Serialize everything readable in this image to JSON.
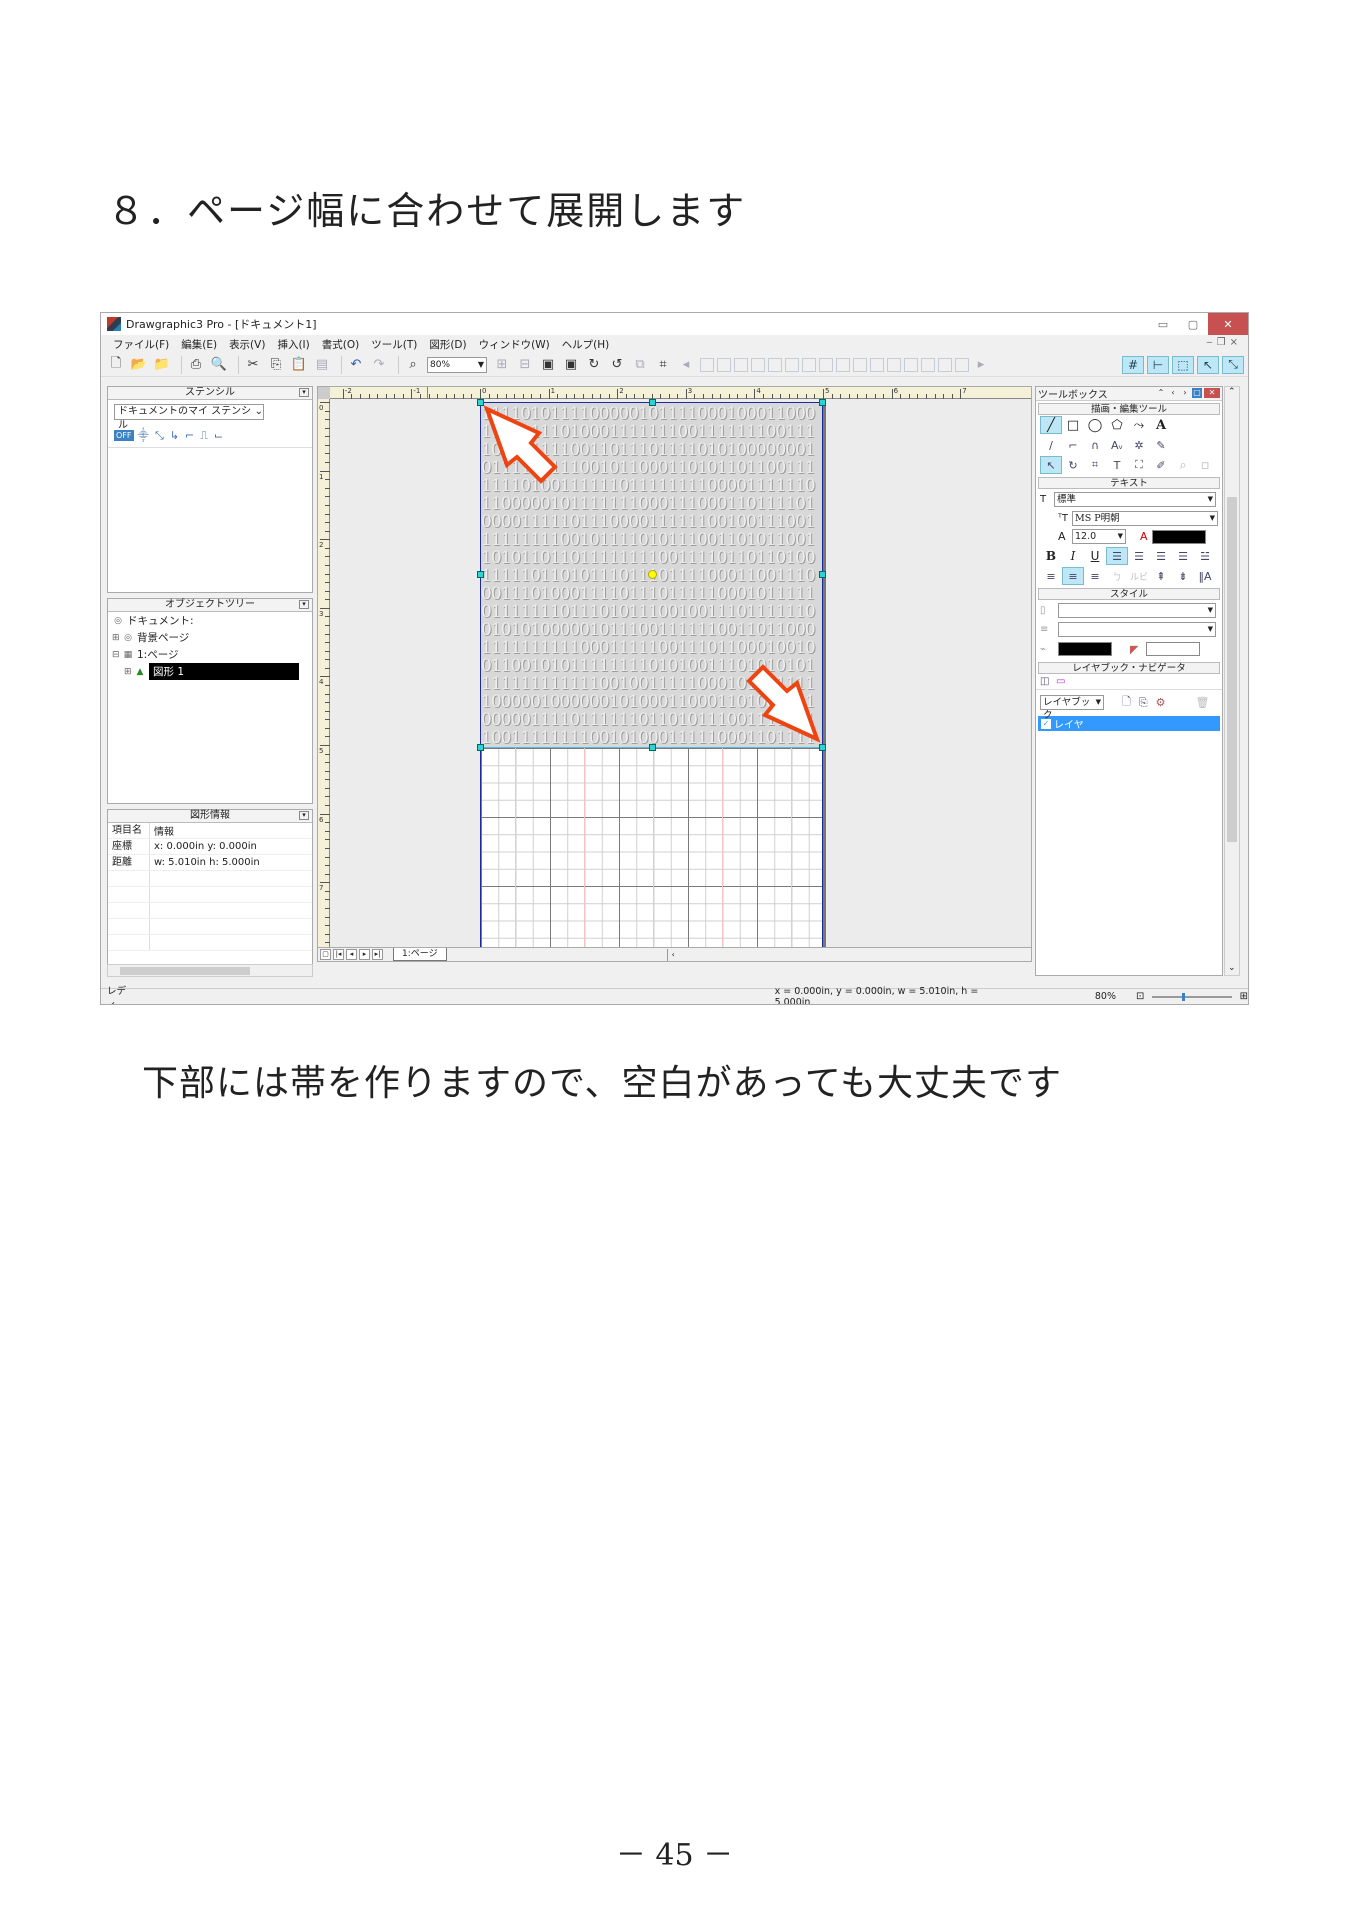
{
  "heading": "８．ページ幅に合わせて展開します",
  "caption": "下部には帯を作りますので、空白があっても大丈夫です",
  "page_number": "－ 45 －",
  "window": {
    "title": "Drawgraphic3 Pro - [ドキュメント1]",
    "controls": [
      "▭",
      "▢",
      "✕"
    ]
  },
  "menu": [
    "ファイル(F)",
    "編集(E)",
    "表示(V)",
    "挿入(I)",
    "書式(O)",
    "ツール(T)",
    "図形(D)",
    "ウィンドウ(W)",
    "ヘルプ(H)"
  ],
  "toolbar": {
    "zoom": "80%"
  },
  "stencil_panel": {
    "title": "ステンシル",
    "selected": "ドキュメントのマイ ステンシル",
    "off_label": "OFF"
  },
  "object_tree": {
    "title": "オブジェクトツリー",
    "items": [
      "ドキュメント:",
      "背景ページ",
      "1:ページ",
      "図形 1"
    ]
  },
  "shape_info": {
    "title": "図形情報",
    "header": {
      "key": "項目名",
      "value": "情報"
    },
    "rows": [
      {
        "key": "座標",
        "value": "x: 0.000in y: 0.000in"
      },
      {
        "key": "距離",
        "value": "w: 5.010in h: 5.000in"
      }
    ]
  },
  "canvas": {
    "page_tab": "1:ページ",
    "ruler_x_labels": [
      "-2",
      "-1",
      "0",
      "1",
      "2",
      "3",
      "4",
      "5",
      "6",
      "7"
    ],
    "ruler_y_labels": [
      "0",
      "1",
      "2",
      "3",
      "4",
      "5",
      "6",
      "7"
    ],
    "binary_pattern": "1111010111100000101111000100011000111101110100011111110011111110011110011111100110111011110101000000010111101111001011000110101101100111111101001111110111111110000111111011000001011111110001110001101111010000111110111000011111100100111001111111110010111101011100110101100110101101101111111100111101101101001111101101011101110111100011001110001110100011110111011111000101111101111111011101011100100111011111100101010000010111001111110011011000111111111100011111001110110001001001100101011111111010100111010101011111111111110010011111000101001111100000100000010100011000110100111100000111101111110110101110011110011001111111100101000111110001101111000001111110001011010110000111100011111111010110011110001101101011101001001101100011000011110111100001001100111110011111111110111011001110011111101"
  },
  "toolbox": {
    "title": "ツールボックス",
    "sections": {
      "draw": "描画・編集ツール",
      "text": "テキスト",
      "style": "スタイル",
      "layer": "レイヤブック・ナビゲータ"
    },
    "text_style": "標準",
    "font": "MS P明朝",
    "font_size": "12.0",
    "layerbook_label": "レイヤブック",
    "layer_name": "レイヤ"
  },
  "statusbar": {
    "ready": "レディ",
    "coords": "x =  0.000in, y =  0.000in, w =  5.010in, h =  5.000in",
    "zoom": "80%"
  },
  "colors": {
    "accent": "#3399ff",
    "arrow": "#ee4411",
    "handle": "#2ed3d3",
    "page_border": "#1c2b9a"
  }
}
